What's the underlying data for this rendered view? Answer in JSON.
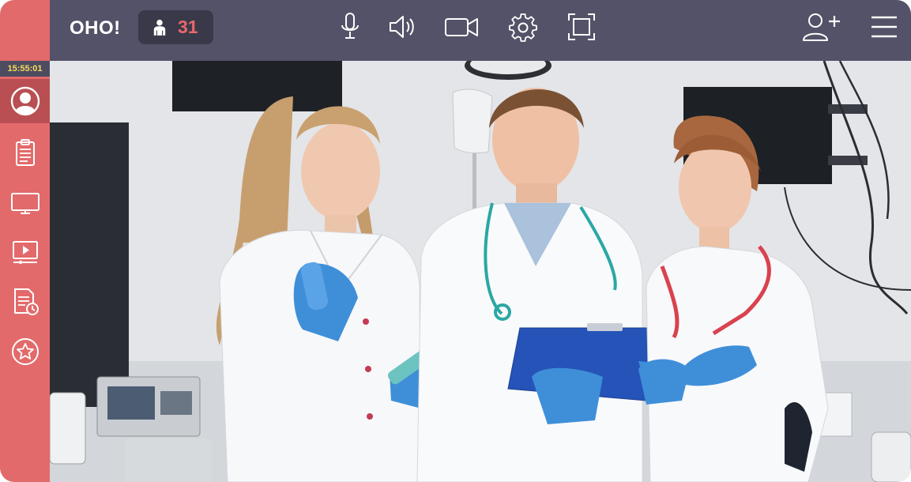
{
  "app": {
    "brand": "OHO!",
    "participant_count": "31"
  },
  "sidebar": {
    "clock": "15:55:01",
    "items": [
      {
        "name": "profile",
        "icon": "user-avatar-icon",
        "active": true
      },
      {
        "name": "clipboard",
        "icon": "clipboard-icon"
      },
      {
        "name": "screen",
        "icon": "monitor-icon"
      },
      {
        "name": "video-player",
        "icon": "video-player-icon"
      },
      {
        "name": "schedule-document",
        "icon": "document-clock-icon"
      },
      {
        "name": "favorites",
        "icon": "star-icon"
      }
    ]
  },
  "toolbar": {
    "icons": [
      "microphone-icon",
      "speaker-icon",
      "camera-icon",
      "settings-icon",
      "fullscreen-icon",
      "add-user-icon",
      "menu-icon"
    ]
  },
  "video": {
    "description_icon": "video-feed"
  },
  "colors": {
    "sidebar": "#e36a6b",
    "sidebar_active": "#b94f52",
    "topbar": "#545268",
    "counter_bg": "#3a394a",
    "counter_text": "#e8686a",
    "clock_text": "#f5dc5a"
  }
}
